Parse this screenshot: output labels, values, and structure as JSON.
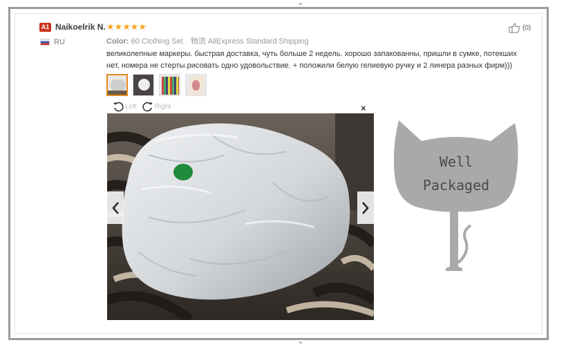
{
  "reviewer": {
    "badge": "A1",
    "name": "Naikoelrik N.",
    "stars": [
      "★",
      "★",
      "★",
      "★",
      "★"
    ],
    "country": "RU"
  },
  "meta": {
    "color_label": "Color:",
    "color_value": "60 Clothing Set",
    "logistics_label": "物流",
    "logistics_value": "AliExpress Standard Shipping"
  },
  "helpful": {
    "count": "(0)",
    "icon": "thumbs-up-icon"
  },
  "review_text": "великолепные маркеры. быстрая доставка, чуть больше 2 недель. хорошо запакованны, пришли в сумке, потекших нет, номера не стерты.рисовать одно удовольствие. + положили белую гелиевую ручку и 2 линера разных фирм)))",
  "viewer": {
    "rotate_left": "Left",
    "rotate_right": "Right",
    "close": "×"
  },
  "overlay": {
    "line1": "Well",
    "line2": "Packaged"
  },
  "colors": {
    "badge": "#c8321c",
    "stars": "#f5a623",
    "active_thumb_border": "#e28a1a",
    "cat": "#a9a9a9"
  }
}
